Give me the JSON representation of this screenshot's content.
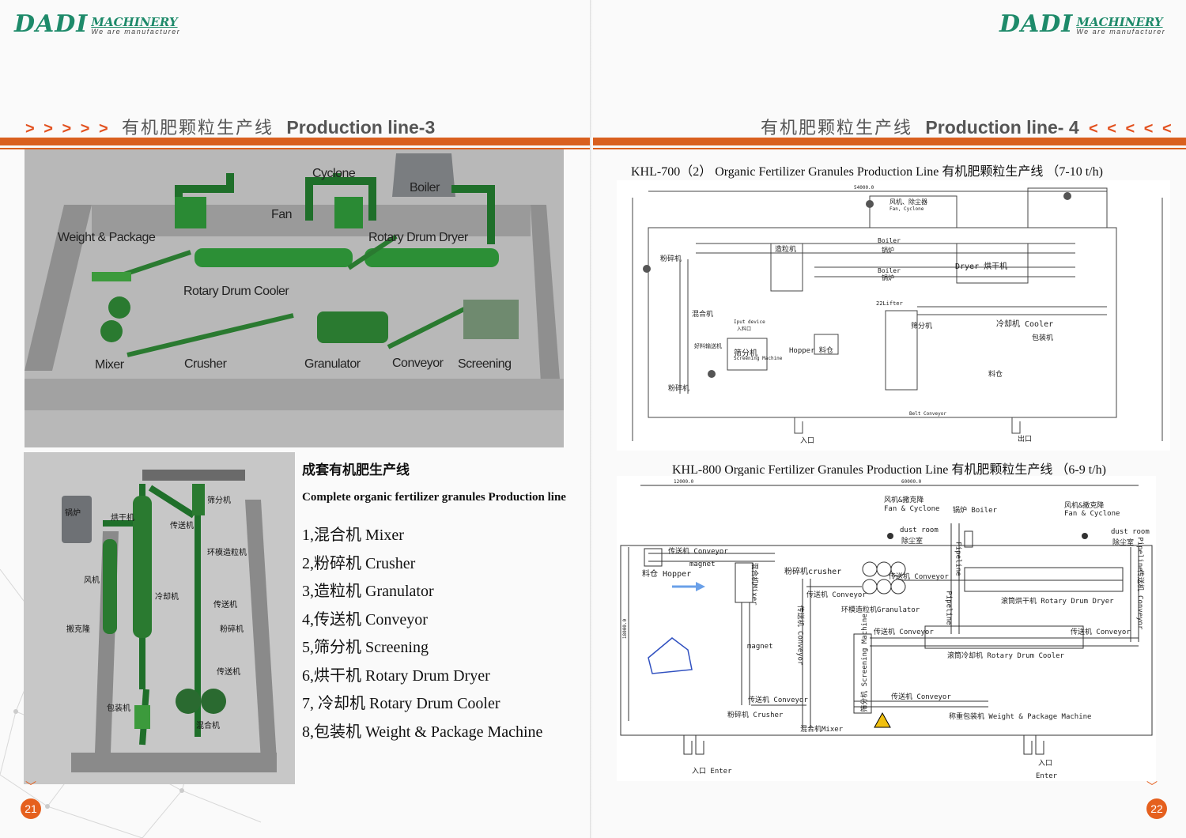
{
  "left": {
    "logo": {
      "mark": "DADI",
      "brand": "MACHINERY",
      "tagline": "We are manufacturer"
    },
    "title": {
      "arrows": "> > > > >",
      "cn": "有机肥颗粒生产线",
      "en": "Production line-3"
    },
    "diagram_labels": {
      "cyclone": "Cyclone",
      "boiler": "Boiler",
      "fan": "Fan",
      "weight_package": "Weight & Package",
      "rotary_dryer": "Rotary Drum Dryer",
      "rotary_cooler": "Rotary Drum Cooler",
      "mixer": "Mixer",
      "crusher": "Crusher",
      "granulator": "Granulator",
      "conveyor": "Conveyor",
      "screening": "Screening"
    },
    "plan_labels": {
      "boiler": "锅炉",
      "dryer": "烘干机",
      "conveyor1": "传送机",
      "screen": "筛分机",
      "fan": "风机",
      "ring_granulator": "环模造粒机",
      "cooler": "冷却机",
      "conveyor2": "传送机",
      "crusher": "粉碎机",
      "cyclone": "搬克隆",
      "conveyor3": "传送机",
      "packer": "包装机",
      "mixer": "混合机"
    },
    "list": {
      "heading": "成套有机肥生产线",
      "subheading": "Complete organic fertilizer granules Production line",
      "items": [
        "1,混合机 Mixer",
        "2,粉碎机 Crusher",
        "3,造粒机 Granulator",
        "4,传送机 Conveyor",
        "5,筛分机 Screening",
        "6,烘干机 Rotary Drum Dryer",
        "7, 冷却机 Rotary Drum Cooler",
        "8,包装机 Weight & Package Machine"
      ]
    },
    "page_number": "21"
  },
  "right": {
    "logo": {
      "mark": "DADI",
      "brand": "MACHINERY",
      "tagline": "We are manufacturer"
    },
    "title": {
      "cn": "有机肥颗粒生产线",
      "en": "Production line- 4",
      "arrows": "< < < < <"
    },
    "khl700": {
      "caption": "KHL-700（2） Organic Fertilizer Granules Production Line 有机肥颗粒生产线 （7-10 t/h)",
      "labels": {
        "dim": "54000.0",
        "fan_cyclone": "风机、除尘器",
        "fan_cyclone_en": "Fan, Cyclone",
        "boiler1": "Boiler",
        "boiler1_cn": "锅炉",
        "boiler2": "Boiler",
        "boiler2_cn": "锅炉",
        "dryer": "Dryer 烘干机",
        "cooler": "冷却机  Cooler",
        "granulator": "造粒机",
        "crusher": "粉碎机",
        "mixer": "混合机",
        "input": "Iput device",
        "input_cn": "入料口",
        "screen": "筛分机",
        "screen_en": "Screening Machine",
        "hopper": "Hopper 料仓",
        "hopper2": "料仓",
        "packing": "包装机",
        "lifter": "22Lifter",
        "screen2": "筛分机",
        "crusher2": "粉碎机",
        "belt_conveyor": "Belt Conveyor",
        "entry": "入口",
        "exit": "出口",
        "conveyor_cn": "好料输送机"
      }
    },
    "khl800": {
      "caption": "KHL-800 Organic Fertilizer Granules Production Line 有机肥颗粒生产线 （6-9 t/h)",
      "labels": {
        "dim1": "12000.0",
        "dim2": "60000.0",
        "dim3": "18000.0",
        "fan_cyclone1": "风机&撒克降",
        "fan_cyclone1_en": "Fan & Cyclone",
        "boiler": "锅炉 Boiler",
        "fan_cyclone2": "风机&撒克降",
        "fan_cyclone2_en": "Fan & Cyclone",
        "dust_room1": "dust room",
        "dust_room1_cn": "除尘室",
        "dust_room2": "dust room",
        "dust_room2_cn": "除尘室",
        "pipeline1": "Pipeline",
        "pipeline2": "Pipeline",
        "pipeline3": "Pipeline",
        "conveyor_top": "传送机 Conveyor",
        "magnet1": "magnet",
        "hopper": "料仓 Hopper",
        "mixer_v": "混合机Mixer",
        "crusher_top": "粉碎机crusher",
        "conveyor_a": "传送机 Conveyor",
        "conveyor_b": "传送机 Conveyor",
        "granulator": "环模造粒机Granulator",
        "conveyor_v": "传送机 Conveyor",
        "dryer": "滚筒烘干机 Rotary Drum Dryer",
        "conveyor_right": "传送机 Conveyor",
        "conveyor_c": "传送机 Conveyor",
        "conveyor_d": "传送机 Conveyor",
        "cooler": "滚筒冷却机 Rotary Drum Cooler",
        "screening_v": "筛分机 Screening Machine",
        "magnet2": "magnet",
        "conveyor_e": "传送机 Conveyor",
        "conveyor_f": "传送机 Conveyor",
        "crusher_bottom": "粉碎机 Crusher",
        "mixer_bottom": "混合机Mixer",
        "packer": "称重包装机 Weight & Package Machine",
        "enter1": "入口 Enter",
        "enter2": "入口",
        "enter2_en": "Enter"
      }
    },
    "page_number": "22"
  }
}
